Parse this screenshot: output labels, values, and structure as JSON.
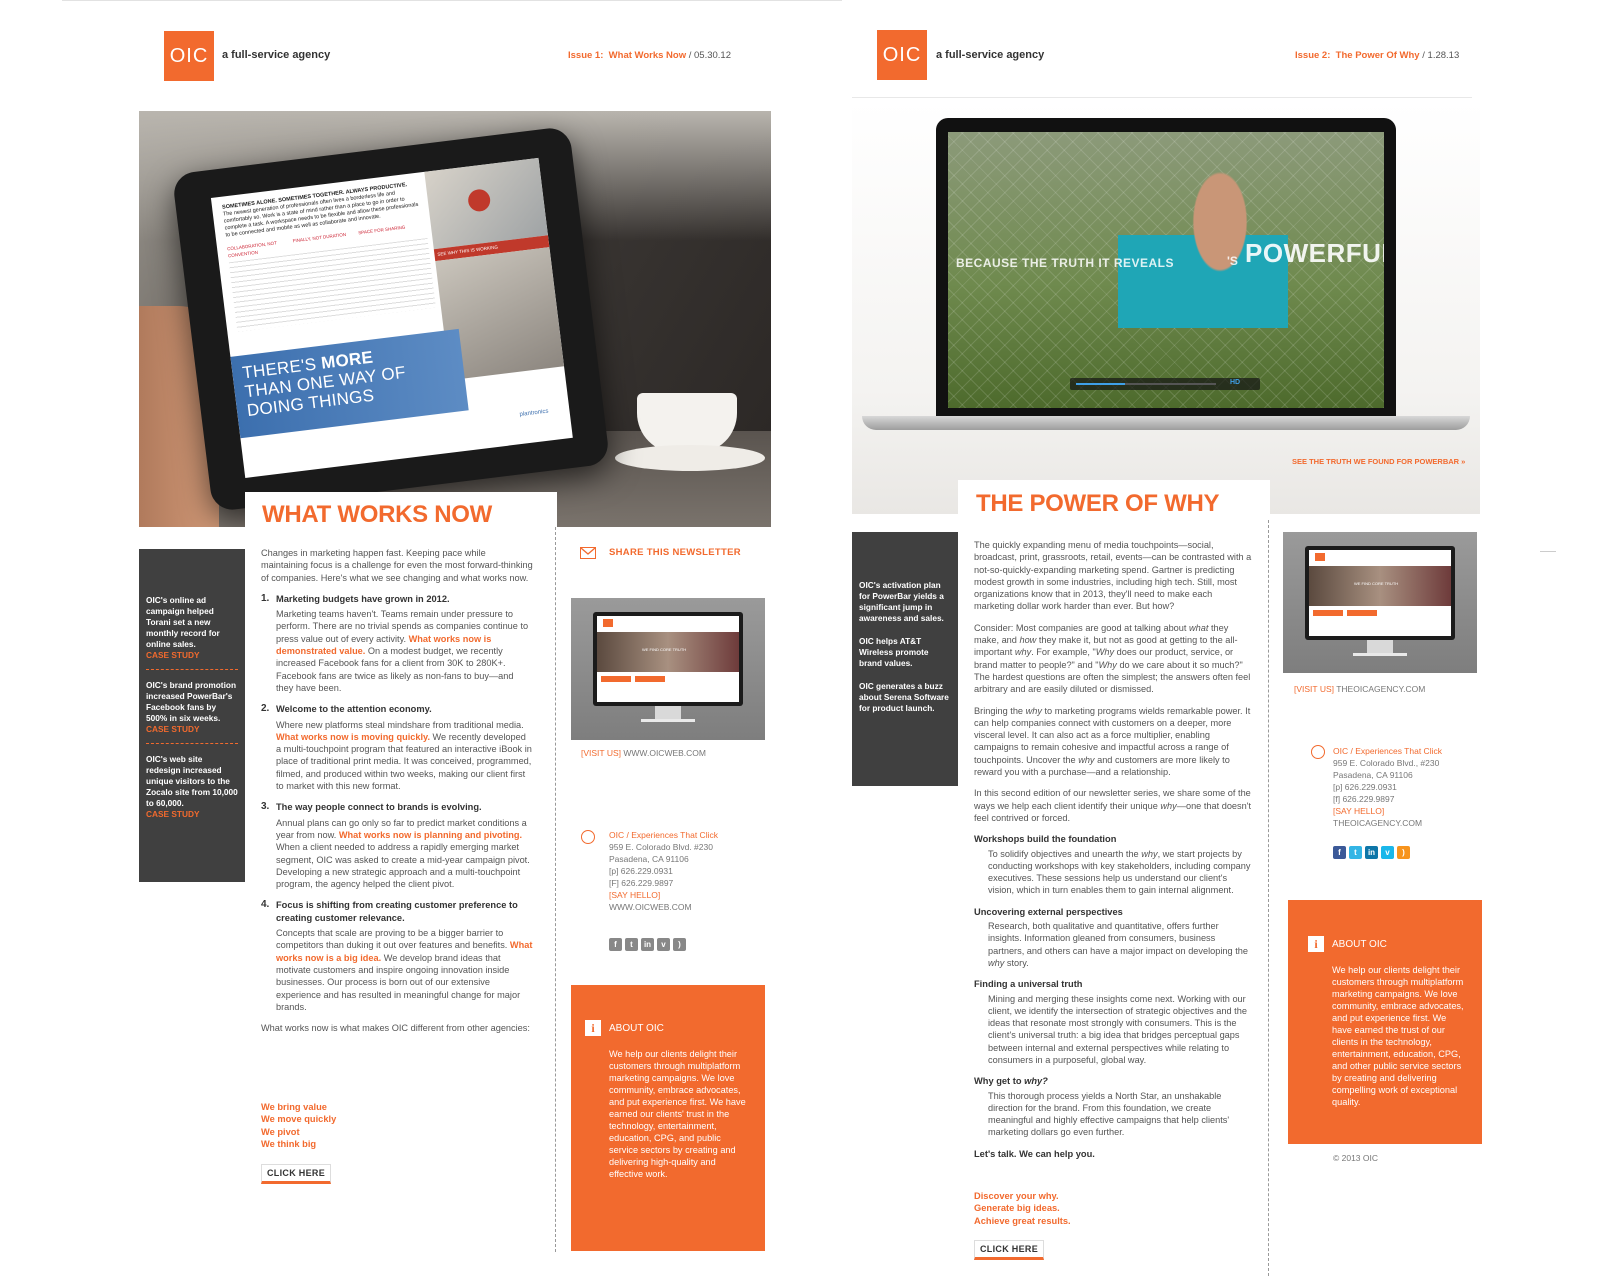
{
  "left": {
    "logo": "OIC",
    "tagline": "a full-service agency",
    "issue_label": "Issue 1:",
    "issue_title": "What Works Now",
    "issue_sep": "/",
    "issue_date": "05.30.12",
    "hero": {
      "tablet_heading": "SOMETIMES ALONE. SOMETIMES TOGETHER. ALWAYS PRODUCTIVE.",
      "tablet_intro": "The newest generation of professionals often lives a borderless life and comfortably so. Work is a state of mind rather than a place to go in order to complete a task. A workspace needs to be flexible and allow these professionals to be connected and mobile as well as collaborate and innovate.",
      "tablet_col_heads": [
        "COLLABORATION, NOT CONVENTION",
        "FINALLY, NOT DURATION",
        "SPACE FOR SHARING"
      ],
      "tablet_link": "SEE WHY THIS IS WORKING",
      "tablet_banner_1": "THERE'S ",
      "tablet_banner_bold": "MORE",
      "tablet_banner_2": "THAN ONE WAY OF",
      "tablet_banner_3": "DOING THINGS",
      "tablet_brand": "plantronics"
    },
    "title": "WHAT WORKS NOW",
    "intro": "Changes in marketing happen fast. Keeping pace while maintaining focus is a challenge for even the most forward-thinking of companies. Here's what we see changing and what works now.",
    "items": [
      {
        "num": "1.",
        "head": "Marketing budgets have grown in 2012.",
        "pre": "Marketing teams haven't. Teams remain under pressure to perform. There are no trivial spends as companies continue to press value out of every activity. ",
        "hl": "What works now is demonstrated value.",
        "post": " On a modest budget, we recently increased Facebook fans for a client from 30K to 280K+. Facebook fans are twice as likely as non-fans to buy—and they have been."
      },
      {
        "num": "2.",
        "head": "Welcome to the attention economy.",
        "pre": "Where new platforms steal mindshare from traditional media. ",
        "hl": "What works now is moving quickly.",
        "post": " We recently developed a multi-touchpoint program that featured an interactive iBook in place of traditional print media. It was conceived, programmed, filmed, and produced within two weeks, making our client first to market with this new format."
      },
      {
        "num": "3.",
        "head": "The way people connect to brands is evolving.",
        "pre": "Annual plans can go only so far to predict market conditions a year from now. ",
        "hl": "What works now is planning and pivoting.",
        "post": " When a client needed to address a rapidly emerging market segment, OIC was asked to create a mid-year campaign pivot. Developing a new strategic approach and a multi-touchpoint program, the agency helped the client pivot."
      },
      {
        "num": "4.",
        "head": "Focus is shifting from creating customer preference to creating customer relevance.",
        "pre": "Concepts that scale are proving to be a bigger barrier to competitors than duking it out over features and benefits. ",
        "hl": "What works now is a big idea.",
        "post": " We develop brand ideas that motivate customers and inspire ongoing innovation inside businesses. Our process is born out of our extensive experience and has resulted in meaningful change for major brands."
      }
    ],
    "closing": "What works now is what makes OIC different from other agencies:",
    "links": [
      "We bring value",
      "We move quickly",
      "We pivot",
      "We think big"
    ],
    "click": "CLICK HERE",
    "sidebar": [
      {
        "text": "OIC's online ad campaign helped Torani set a new monthly record for online sales.",
        "cs": "CASE STUDY"
      },
      {
        "text": "OIC's brand promotion increased PowerBar's Facebook fans by 500% in six weeks.",
        "cs": "CASE STUDY"
      },
      {
        "text": "OIC's web site redesign increased unique visitors to the Zocalo site from 10,000 to 60,000.",
        "cs": "CASE STUDY"
      }
    ],
    "share": "SHARE THIS NEWSLETTER",
    "thumb_tagline": "WE FIND CORE TRUTH",
    "visit_label": "[VISIT US]",
    "visit_url": "WWW.OICWEB.COM",
    "contact": {
      "head": "OIC /  Experiences That Click",
      "addr1": "959 E. Colorado Blvd. #230",
      "addr2": "Pasadena, CA 91106",
      "phone": "[p] 626.229.0931",
      "fax": "[F] 626.229.9897",
      "say": "[SAY HELLO]",
      "web": "WWW.OICWEB.COM"
    },
    "about_head": "ABOUT OIC",
    "about_text": "We help our clients delight their customers through multiplatform marketing campaigns. We love community, embrace advocates, and put experience first. We have earned our clients' trust in the technology, entertainment, education, CPG, and public service sectors by creating and delivering high-quality and effective work."
  },
  "right": {
    "logo": "OIC",
    "tagline": "a full-service agency",
    "issue_label": "Issue 2:",
    "issue_title": "The Power Of Why",
    "issue_sep": "/",
    "issue_date": "1.28.13",
    "hero_text_1": "BECAUSE THE TRUTH IT REVEALS",
    "hero_text_2": "'S",
    "hero_text_big": "POWERFUL",
    "hero_hd": "HD",
    "hero_link": "SEE THE TRUTH WE FOUND FOR POWERBAR »",
    "title": "THE POWER OF WHY",
    "paras": [
      {
        "a": "The quickly expanding menu of media touchpoints—social, broadcast, print, grassroots, retail, events—can be contrasted with a not-so-quickly-expanding marketing spend. Gartner is predicting modest growth in some industries, including high tech. Still, most organizations know that in 2013, they'll need to make each marketing dollar work harder than ever. But how?"
      },
      {
        "a": "Consider: Most companies are good at talking about ",
        "i1": "what",
        "b": " they make, and ",
        "i2": "how",
        "c": " they make it, but not as good at getting to the all-important ",
        "i3": "why",
        "d": ". For example, \"",
        "i4": "Why",
        "e": " does our product, service, or brand matter to people?\" and \"",
        "i5": "Why",
        "f": " do we care about it so much?\" The hardest questions are often the simplest; the answers often feel arbitrary and are easily diluted or dismissed."
      },
      {
        "a": "Bringing the ",
        "i1": "why",
        "b": " to marketing programs wields remarkable power. It can help companies connect with customers on a deeper, more visceral level. It can also act as a force multiplier, enabling campaigns to remain cohesive and impactful across a range of touchpoints. Uncover the ",
        "i2": "why",
        "c": " and customers are more likely to reward you with a purchase—and a relationship."
      },
      {
        "a": "In this second edition of our newsletter series, we share some of the ways we help each client identify their unique ",
        "i1": "why",
        "b": "—one that doesn't feel contrived or forced."
      }
    ],
    "sections": [
      {
        "head": "Workshops build the foundation",
        "a": "To solidify objectives and unearth the ",
        "i": "why",
        "b": ", we start projects by conducting workshops with key stakeholders, including company executives. These sessions help us understand our client's vision, which in turn enables them to gain internal alignment."
      },
      {
        "head": "Uncovering external perspectives",
        "a": "Research, both qualitative and quantitative, offers further insights. Information gleaned from consumers, business partners, and others can have a major impact on developing the ",
        "i": "why",
        "b": " story."
      },
      {
        "head": "Finding a universal truth",
        "a": "Mining and merging these insights come next. Working with our client, we identify the intersection of strategic objectives and the ideas that resonate most strongly with consumers. This is the client's universal truth: a big idea that bridges perceptual gaps between internal and external perspectives while relating to consumers in a purposeful, global way.",
        "i": "",
        "b": ""
      },
      {
        "head": "Why get to ",
        "headi": "why?",
        "a": "This thorough process yields a North Star, an unshakable direction for the brand. From this foundation, we create meaningful and highly effective campaigns that help clients' marketing dollars go even further.",
        "i": "",
        "b": ""
      }
    ],
    "talk": "Let's talk. We can help you.",
    "links": [
      "Discover your why.",
      "Generate big ideas.",
      "Achieve great results."
    ],
    "click": "CLICK HERE",
    "sidebar": [
      "OIC's activation plan for PowerBar yields a significant jump in awareness and sales.",
      "OIC helps AT&T Wireless promote brand values.",
      "OIC generates a buzz about Serena Software for product launch."
    ],
    "thumb_tagline": "WE FIND CORE TRUTH",
    "visit_label": "[VISIT US]",
    "visit_url": "THEOICAGENCY.COM",
    "contact": {
      "head": "OIC /  Experiences That Click",
      "addr1": "959 E. Colorado Blvd., #230",
      "addr2": "Pasadena, CA 91106",
      "phone": "[p] 626.229.0931",
      "fax": "[f] 626.229.9897",
      "say": "[SAY HELLO]",
      "web": "THEOICAGENCY.COM"
    },
    "about_head": "ABOUT OIC",
    "about_text": "We help our clients delight their customers through multiplatform marketing campaigns. We love community, embrace advocates, and put experience first. We have earned the trust of our clients in the technology, entertainment, education, CPG, and other public service sectors by creating and delivering compelling work of exceptional quality.",
    "copyright": "© 2013 OIC"
  },
  "social_icons": [
    "facebook-icon",
    "twitter-icon",
    "linkedin-icon",
    "vimeo-icon",
    "rss-icon"
  ],
  "colors": {
    "accent": "#f26a2e",
    "sidebar": "#404040",
    "text": "#555555"
  }
}
